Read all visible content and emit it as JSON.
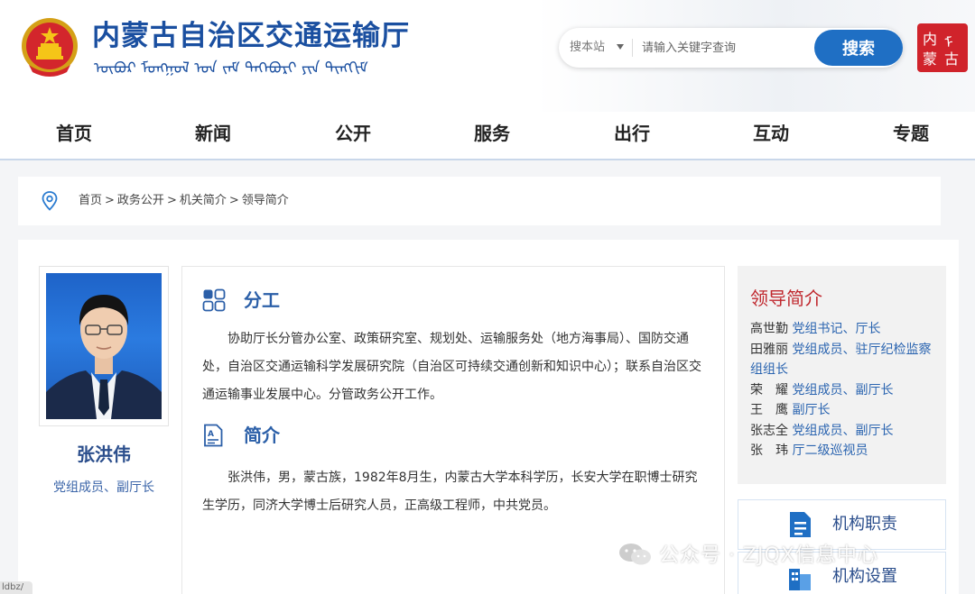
{
  "header": {
    "site_title": "内蒙古自治区交通运输厅",
    "mongol_text": "ᠥᠪᠥᠷ ᠮᠣᠩᠭᠣᠯ ᠤᠨ ᠵᠠᠮ ᠲᠡᠭᠡᠪᠦᠷᠢ ᠶᠢᠨ ᠲᠢᠩᠬᠢᠮ",
    "search_scope": "搜本站",
    "search_placeholder": "请输入关键字查询",
    "search_button": "搜索"
  },
  "nav": [
    "首页",
    "新闻",
    "公开",
    "服务",
    "出行",
    "互动",
    "专题"
  ],
  "breadcrumb": [
    "首页",
    "政务公开",
    "机关简介",
    "领导简介"
  ],
  "leader": {
    "name": "张洪伟",
    "position": "党组成员、副厅长",
    "duty_title": "分工",
    "duty_text": "协助厅长分管办公室、政策研究室、规划处、运输服务处（地方海事局）、国防交通处，自治区交通运输科学发展研究院（自治区可持续交通创新和知识中心）；联系自治区交通运输事业发展中心。分管政务公开工作。",
    "bio_title": "简介",
    "bio_text": "张洪伟，男，蒙古族，1982年8月生，内蒙古大学本科学历，长安大学在职博士研究生学历，同济大学博士后研究人员，正高级工程师，中共党员。"
  },
  "sidebar": {
    "title": "领导简介",
    "leaders": [
      {
        "name": "高世勤",
        "role": "党组书记、厅长"
      },
      {
        "name": "田雅丽",
        "role": "党组成员、驻厅纪检监察组组长"
      },
      {
        "name": "荣　耀",
        "role": "党组成员、副厅长"
      },
      {
        "name": "王　鹰",
        "role": "副厅长"
      },
      {
        "name": "张志全",
        "role": "党组成员、副厅长"
      },
      {
        "name": "张　玮",
        "role": "厅二级巡视员"
      }
    ],
    "buttons": [
      "机构职责",
      "机构设置"
    ]
  },
  "watermark": "公众号 · ZJQX信息中心",
  "corner_stub": "ldbz/",
  "colors": {
    "brand_blue": "#1a4fa0",
    "search_button": "#1f6fc4",
    "accent_red": "#c0282e",
    "link_blue": "#2a64b0"
  }
}
